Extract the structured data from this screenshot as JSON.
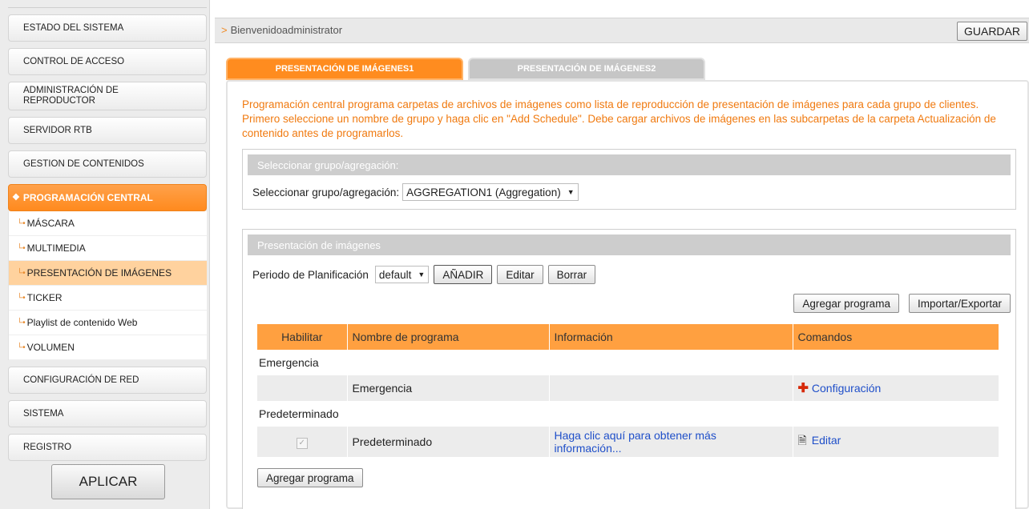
{
  "sidebar": {
    "items": [
      {
        "label": "ESTADO DEL SISTEMA"
      },
      {
        "label": "CONTROL DE ACCESO"
      },
      {
        "label": "ADMINISTRACIÓN DE REPRODUCTOR"
      },
      {
        "label": "SERVIDOR RTB"
      },
      {
        "label": "GESTION DE CONTENIDOS"
      },
      {
        "label": "PROGRAMACIÓN CENTRAL"
      },
      {
        "label": "CONFIGURACIÓN DE RED"
      },
      {
        "label": "SISTEMA"
      },
      {
        "label": "REGISTRO"
      }
    ],
    "subitems": [
      {
        "label": "MÁSCARA"
      },
      {
        "label": "MULTIMEDIA"
      },
      {
        "label": "PRESENTACIÓN DE IMÁGENES"
      },
      {
        "label": "TICKER"
      },
      {
        "label": "Playlist de contenido Web"
      },
      {
        "label": "VOLUMEN"
      }
    ],
    "apply_label": "APLICAR"
  },
  "header": {
    "breadcrumb": "Bienvenidoadministrator",
    "save_label": "GUARDAR"
  },
  "tabs": [
    {
      "label": "PRESENTACIÓN DE IMÁGENES1"
    },
    {
      "label": "PRESENTACIÓN DE IMÁGENES2"
    }
  ],
  "description": "Programación central programa carpetas de archivos de imágenes como lista de reproducción de presentación de imágenes para cada grupo de clientes. Primero seleccione un nombre de grupo y haga clic en \"Add Schedule\". Debe cargar archivos de imágenes en las subcarpetas de la carpeta Actualización de contenido antes de programarlos.",
  "group_section": {
    "header": "Seleccionar grupo/agregación:",
    "label": "Seleccionar grupo/agregación:",
    "selected": "AGGREGATION1 (Aggregation)"
  },
  "slides_section": {
    "header": "Presentación de imágenes",
    "period_label": "Periodo de Planificación",
    "period_selected": "default",
    "add_label": "AÑADIR",
    "edit_label": "Editar",
    "delete_label": "Borrar",
    "add_program_label": "Agregar programa",
    "import_export_label": "Importar/Exportar",
    "bottom_add_program_label": "Agregar programa"
  },
  "table": {
    "columns": [
      "Habilitar",
      "Nombre de programa",
      "Información",
      "Comandos"
    ],
    "groups": [
      {
        "name": "Emergencia",
        "row": {
          "name": "Emergencia",
          "info": "",
          "command": "Configuración"
        }
      },
      {
        "name": "Predeterminado",
        "row": {
          "name": "Predeterminado",
          "info": "Haga clic aquí para obtener más información...",
          "command": "Editar"
        }
      }
    ]
  },
  "colors": {
    "accent": "#ff8c1f",
    "table_header": "#ffa040",
    "description_text": "#f07a10",
    "link": "#1f4fc9"
  }
}
